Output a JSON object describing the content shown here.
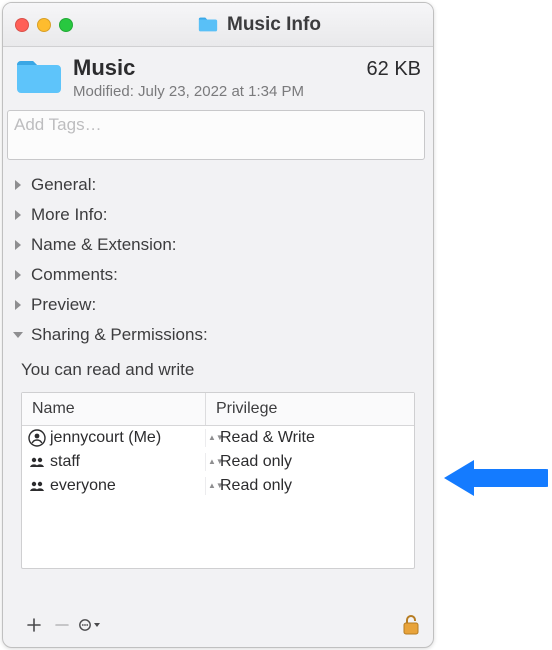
{
  "window": {
    "title": "Music Info"
  },
  "header": {
    "name": "Music",
    "size": "62 KB",
    "modified_label": "Modified:",
    "modified_value": "July 23, 2022 at 1:34 PM"
  },
  "tags": {
    "placeholder": "Add Tags…"
  },
  "sections": {
    "general": "General:",
    "more_info": "More Info:",
    "name_ext": "Name & Extension:",
    "comments": "Comments:",
    "preview": "Preview:",
    "sharing": "Sharing & Permissions:"
  },
  "permissions": {
    "summary": "You can read and write",
    "columns": {
      "name": "Name",
      "privilege": "Privilege"
    },
    "rows": [
      {
        "icon": "person-icon",
        "name": "jennycourt (Me)",
        "privilege": "Read & Write"
      },
      {
        "icon": "group-icon",
        "name": "staff",
        "privilege": "Read only"
      },
      {
        "icon": "group-icon",
        "name": "everyone",
        "privilege": "Read only"
      }
    ]
  },
  "toolbar": {
    "add": "+",
    "remove": "−",
    "action": "⊙"
  },
  "accent": "#147bff"
}
